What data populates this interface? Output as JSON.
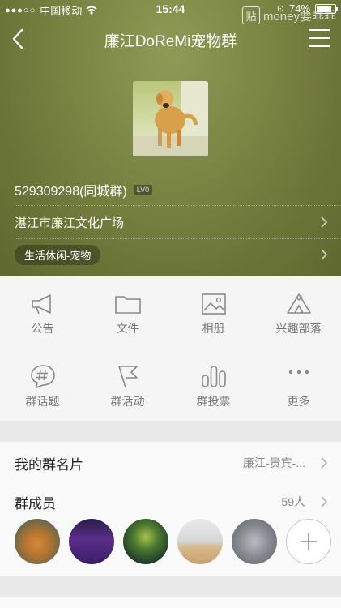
{
  "status_bar": {
    "signal_dots": "●●●○○",
    "carrier": "中国移动",
    "time": "15:44",
    "battery_percent": "74%",
    "battery_level": 0.74
  },
  "watermark": {
    "logo_char": "贴",
    "text": "money要乖乖"
  },
  "nav": {
    "title": "廉江DoReMi宠物群"
  },
  "group": {
    "id_text": "529309298(同城群)",
    "level": "LV0",
    "location": "湛江市廉江文化广场",
    "category": "生活休闲-宠物"
  },
  "features": [
    {
      "label": "公告",
      "icon": "megaphone-icon"
    },
    {
      "label": "文件",
      "icon": "folder-icon"
    },
    {
      "label": "相册",
      "icon": "photo-album-icon"
    },
    {
      "label": "兴趣部落",
      "icon": "tribe-icon"
    },
    {
      "label": "群话题",
      "icon": "topic-hash-icon"
    },
    {
      "label": "群活动",
      "icon": "flag-icon"
    },
    {
      "label": "群投票",
      "icon": "vote-bars-icon"
    },
    {
      "label": "更多",
      "icon": "more-dots-icon"
    }
  ],
  "my_card": {
    "label": "我的群名片",
    "value": "廉江-贵宾-..."
  },
  "members": {
    "label": "群成员",
    "count": "59人"
  },
  "colors": {
    "hero": "#7d8846",
    "icon_gray": "#8a8a8a",
    "text_dark": "#222222"
  }
}
